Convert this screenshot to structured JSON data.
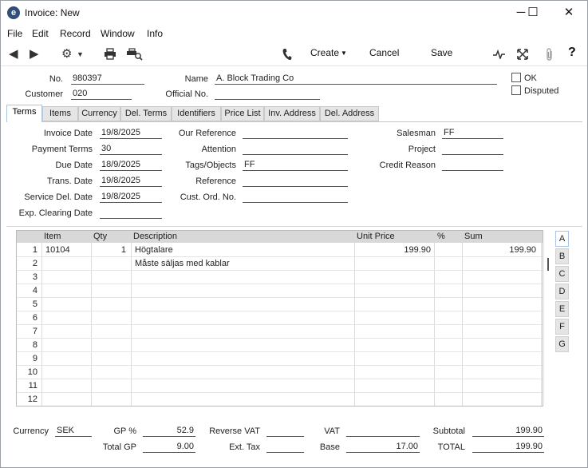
{
  "window": {
    "title": "Invoice: New",
    "minimize": "─",
    "maximize": "☐",
    "close": "✕"
  },
  "menu": [
    "File",
    "Edit",
    "Record",
    "Window",
    "Info"
  ],
  "toolbar": {
    "create": "Create",
    "cancel": "Cancel",
    "save": "Save",
    "help": "?"
  },
  "header": {
    "no_label": "No.",
    "no_value": "980397",
    "name_label": "Name",
    "name_value": "A. Block Trading Co",
    "customer_label": "Customer",
    "customer_value": "020",
    "official_label": "Official No.",
    "official_value": "",
    "ok_label": "OK",
    "disputed_label": "Disputed"
  },
  "tabs": [
    "Terms",
    "Items",
    "Currency",
    "Del. Terms",
    "Identifiers",
    "Price List",
    "Inv. Address",
    "Del. Address"
  ],
  "terms": {
    "invoice_date_label": "Invoice Date",
    "invoice_date": "19/8/2025",
    "payment_terms_label": "Payment Terms",
    "payment_terms": "30",
    "due_date_label": "Due Date",
    "due_date": "18/9/2025",
    "trans_date_label": "Trans. Date",
    "trans_date": "19/8/2025",
    "service_del_date_label": "Service Del. Date",
    "service_del_date": "19/8/2025",
    "exp_clearing_date_label": "Exp. Clearing Date",
    "exp_clearing_date": "",
    "our_reference_label": "Our Reference",
    "our_reference": "",
    "attention_label": "Attention",
    "attention": "",
    "tags_label": "Tags/Objects",
    "tags": "FF",
    "reference_label": "Reference",
    "reference": "",
    "cust_ord_label": "Cust. Ord. No.",
    "cust_ord": "",
    "salesman_label": "Salesman",
    "salesman": "FF",
    "project_label": "Project",
    "project": "",
    "credit_reason_label": "Credit Reason",
    "credit_reason": ""
  },
  "grid": {
    "columns": [
      "Item",
      "Qty",
      "Description",
      "Unit Price",
      "%",
      "Sum"
    ],
    "rows": [
      {
        "n": "1",
        "item": "10104",
        "qty": "1",
        "desc": "Högtalare",
        "price": "199.90",
        "pct": "",
        "sum": "199.90"
      },
      {
        "n": "2",
        "item": "",
        "qty": "",
        "desc": "Måste säljas med kablar",
        "price": "",
        "pct": "",
        "sum": ""
      },
      {
        "n": "3",
        "item": "",
        "qty": "",
        "desc": "",
        "price": "",
        "pct": "",
        "sum": ""
      },
      {
        "n": "4",
        "item": "",
        "qty": "",
        "desc": "",
        "price": "",
        "pct": "",
        "sum": ""
      },
      {
        "n": "5",
        "item": "",
        "qty": "",
        "desc": "",
        "price": "",
        "pct": "",
        "sum": ""
      },
      {
        "n": "6",
        "item": "",
        "qty": "",
        "desc": "",
        "price": "",
        "pct": "",
        "sum": ""
      },
      {
        "n": "7",
        "item": "",
        "qty": "",
        "desc": "",
        "price": "",
        "pct": "",
        "sum": ""
      },
      {
        "n": "8",
        "item": "",
        "qty": "",
        "desc": "",
        "price": "",
        "pct": "",
        "sum": ""
      },
      {
        "n": "9",
        "item": "",
        "qty": "",
        "desc": "",
        "price": "",
        "pct": "",
        "sum": ""
      },
      {
        "n": "10",
        "item": "",
        "qty": "",
        "desc": "",
        "price": "",
        "pct": "",
        "sum": ""
      },
      {
        "n": "11",
        "item": "",
        "qty": "",
        "desc": "",
        "price": "",
        "pct": "",
        "sum": ""
      },
      {
        "n": "12",
        "item": "",
        "qty": "",
        "desc": "",
        "price": "",
        "pct": "",
        "sum": ""
      }
    ],
    "side_tabs": [
      "A",
      "B",
      "C",
      "D",
      "E",
      "F",
      "G"
    ]
  },
  "footer": {
    "currency_label": "Currency",
    "currency": "SEK",
    "gp_pct_label": "GP %",
    "gp_pct": "52.9",
    "total_gp_label": "Total GP",
    "total_gp": "9.00",
    "reverse_vat_label": "Reverse VAT",
    "reverse_vat": "",
    "ext_tax_label": "Ext. Tax",
    "ext_tax": "",
    "vat_label": "VAT",
    "vat": "",
    "base_label": "Base",
    "base": "17.00",
    "subtotal_label": "Subtotal",
    "subtotal": "199.90",
    "total_label": "TOTAL",
    "total": "199.90"
  }
}
